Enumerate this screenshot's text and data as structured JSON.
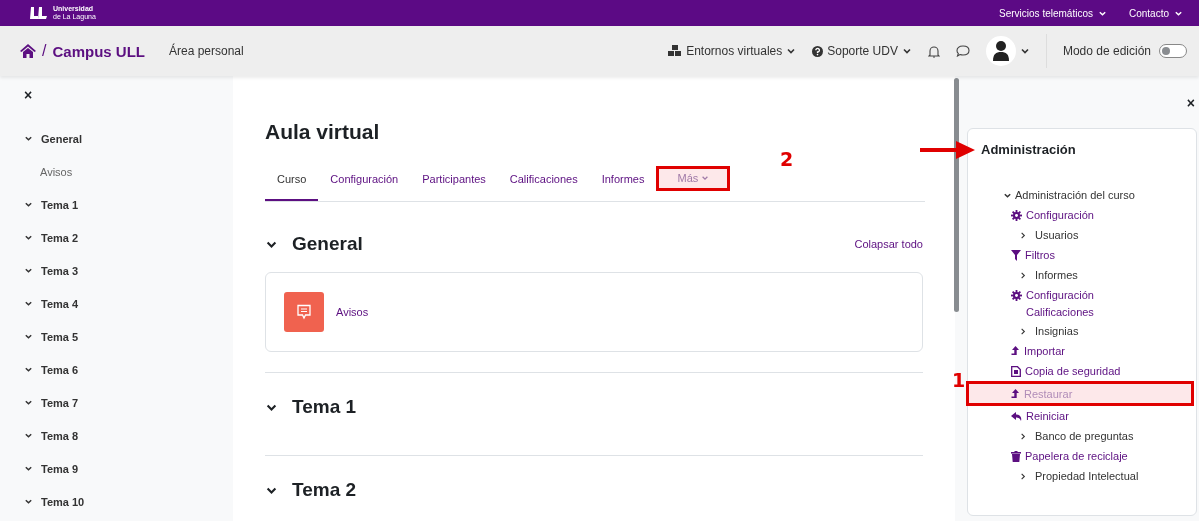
{
  "top_bar": {
    "logo_line_1": "Universidad",
    "logo_line_2": "de La Laguna",
    "menus": [
      {
        "label": "Servicios telemáticos"
      },
      {
        "label": "Contacto"
      }
    ]
  },
  "nav_bar": {
    "separator": "/",
    "site_name": "Campus ULL",
    "links": [
      {
        "label": "Área personal"
      }
    ],
    "menus": [
      {
        "label": "Entornos virtuales",
        "kind": "cubes"
      },
      {
        "label": "Soporte UDV",
        "kind": "help"
      }
    ],
    "edit_mode": {
      "label": "Modo de edición",
      "on": false
    }
  },
  "course_index": {
    "close": "×",
    "sections": [
      {
        "label": "General",
        "expanded": true,
        "children": [
          {
            "label": "Avisos"
          }
        ]
      },
      {
        "label": "Tema 1",
        "expanded": true
      },
      {
        "label": "Tema 2",
        "expanded": true
      },
      {
        "label": "Tema 3",
        "expanded": true
      },
      {
        "label": "Tema 4",
        "expanded": true
      },
      {
        "label": "Tema 5",
        "expanded": true
      },
      {
        "label": "Tema 6",
        "expanded": true
      },
      {
        "label": "Tema 7",
        "expanded": true
      },
      {
        "label": "Tema 8",
        "expanded": true
      },
      {
        "label": "Tema 9",
        "expanded": true
      },
      {
        "label": "Tema 10",
        "expanded": true
      }
    ]
  },
  "main": {
    "title": "Aula virtual",
    "tabs": [
      {
        "label": "Curso",
        "selected": true,
        "highlighted": false
      },
      {
        "label": "Configuración",
        "selected": false,
        "highlighted": false
      },
      {
        "label": "Participantes",
        "selected": false,
        "highlighted": false
      },
      {
        "label": "Calificaciones",
        "selected": false,
        "highlighted": false
      },
      {
        "label": "Informes",
        "selected": false,
        "highlighted": false
      },
      {
        "label": "Más",
        "selected": false,
        "highlighted": true,
        "kind": "dropdown"
      }
    ],
    "collapse_all": "Colapsar todo",
    "sections": [
      {
        "title": "General",
        "expanded": true,
        "activities": [
          {
            "name": "Avisos",
            "kind": "forum"
          }
        ]
      },
      {
        "title": "Tema 1",
        "expanded": true
      },
      {
        "title": "Tema 2",
        "expanded": true
      }
    ]
  },
  "admin_block": {
    "close": "×",
    "title": "Administración",
    "tree": [
      {
        "label": "Administración del curso",
        "expanded": true,
        "children": [
          {
            "label": "Configuración",
            "kind": "gear",
            "highlighted": false
          },
          {
            "label": "Usuarios",
            "kind": "branch",
            "highlighted": false
          },
          {
            "label": "Filtros",
            "kind": "filter",
            "highlighted": false
          },
          {
            "label": "Informes",
            "kind": "branch",
            "highlighted": false
          },
          {
            "label": "Configuración Calificaciones",
            "kind": "gear",
            "highlighted": false
          },
          {
            "label": "Insignias",
            "kind": "branch",
            "highlighted": false
          },
          {
            "label": "Importar",
            "kind": "upload",
            "highlighted": false
          },
          {
            "label": "Copia de seguridad",
            "kind": "backup",
            "highlighted": false
          },
          {
            "label": "Restaurar",
            "kind": "upload",
            "highlighted": true
          },
          {
            "label": "Reiniciar",
            "kind": "reset",
            "highlighted": false
          },
          {
            "label": "Banco de preguntas",
            "kind": "branch",
            "highlighted": false
          },
          {
            "label": "Papelera de reciclaje",
            "kind": "trash",
            "highlighted": false
          },
          {
            "label": "Propiedad Intelectual",
            "kind": "branch",
            "highlighted": false
          }
        ]
      }
    ]
  },
  "annotations": [
    {
      "label": "2",
      "kind": "number"
    },
    {
      "label": "1",
      "kind": "number"
    },
    {
      "kind": "arrow"
    }
  ]
}
